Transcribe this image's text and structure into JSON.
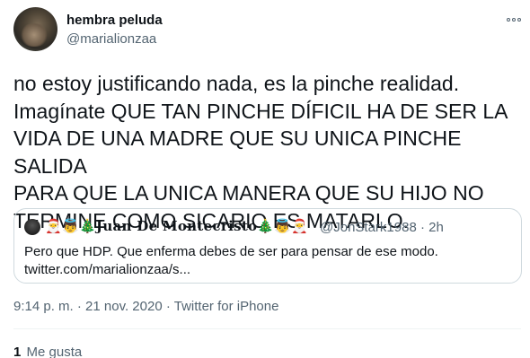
{
  "author": {
    "display_name": "hembra peluda",
    "handle": "@marialionzaa"
  },
  "tweet": {
    "text": "no estoy justificando nada, es la pinche realidad.\nImagínate QUE TAN PINCHE DÍFICIL HA DE SER LA\nVIDA DE UNA MADRE QUE SU UNICA PINCHE SALIDA\nPARA QUE LA UNICA MANERA QUE SU HIJO NO\nTERMINE COMO SICARIO ES MATARLO."
  },
  "quoted_tweet": {
    "display_name": "🎅👼🎄𝐉𝐮𝐚𝐧 𝐃𝐞 𝐌𝐨𝐧𝐭𝐞𝐜𝐫𝐢𝐬𝐭𝐨🎄👼🎅",
    "handle_time": "@JonStark1988 · 2h",
    "text": "Pero que HDP. Que enferma debes de ser para pensar de ese modo.\ntwitter.com/marialionzaa/s..."
  },
  "meta": {
    "timestamp": "9:14 p. m. · 21 nov. 2020",
    "separator": " · ",
    "source": "Twitter for iPhone"
  },
  "stats": {
    "likes_count": "1",
    "likes_label": "Me gusta"
  }
}
